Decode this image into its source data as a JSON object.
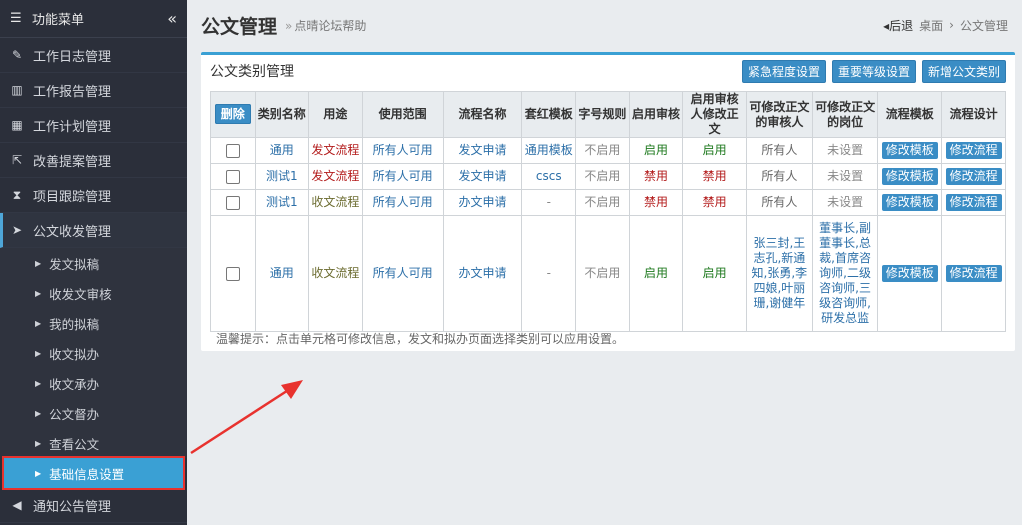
{
  "sidebar": {
    "header": "功能菜单",
    "collapse_glyph": "«",
    "items": [
      {
        "label": "工作日志管理",
        "icon": "✎"
      },
      {
        "label": "工作报告管理",
        "icon": "▥"
      },
      {
        "label": "工作计划管理",
        "icon": "▦"
      },
      {
        "label": "改善提案管理",
        "icon": "⇱"
      },
      {
        "label": "项目跟踪管理",
        "icon": "⧗"
      },
      {
        "label": "公文收发管理",
        "icon": "➤"
      }
    ],
    "subitems": [
      "发文拟稿",
      "收发文审核",
      "我的拟稿",
      "收文拟办",
      "收文承办",
      "公文督办",
      "查看公文",
      "基础信息设置"
    ],
    "last_item": {
      "label": "通知公告管理",
      "icon": "◀"
    }
  },
  "header": {
    "title": "公文管理",
    "subtitle": "点晴论坛帮助",
    "back": "后退",
    "crumb1": "桌面",
    "crumb2": "公文管理"
  },
  "panel": {
    "title": "公文类别管理",
    "buttons": [
      "紧急程度设置",
      "重要等级设置",
      "新增公文类别"
    ],
    "columns": [
      "删除",
      "类别名称",
      "用途",
      "使用范围",
      "流程名称",
      "套红模板",
      "字号规则",
      "启用审核",
      "启用审核人修改正文",
      "可修改正文的审核人",
      "可修改正文的岗位",
      "流程模板",
      "流程设计"
    ],
    "rows": [
      {
        "name": "通用",
        "usage": "发文流程",
        "scope": "所有人可用",
        "flow": "发文申请",
        "template": "通用模板",
        "rule": "不启用",
        "audit": "启用",
        "edit": "启用",
        "editors": "所有人",
        "posts": "未设置",
        "btn1": "修改模板",
        "btn2": "修改流程"
      },
      {
        "name": "测试1",
        "usage": "发文流程",
        "scope": "所有人可用",
        "flow": "发文申请",
        "template": "cscs",
        "rule": "不启用",
        "audit": "禁用",
        "edit": "禁用",
        "editors": "所有人",
        "posts": "未设置",
        "btn1": "修改模板",
        "btn2": "修改流程"
      },
      {
        "name": "测试1",
        "usage": "收文流程",
        "scope": "所有人可用",
        "flow": "办文申请",
        "template": "-",
        "rule": "不启用",
        "audit": "禁用",
        "edit": "禁用",
        "editors": "所有人",
        "posts": "未设置",
        "btn1": "修改模板",
        "btn2": "修改流程"
      },
      {
        "name": "通用",
        "usage": "收文流程",
        "scope": "所有人可用",
        "flow": "办文申请",
        "template": "-",
        "rule": "不启用",
        "audit": "启用",
        "edit": "启用",
        "editors": "张三封,王志孔,新通知,张勇,李四娘,叶丽珊,谢健年",
        "posts": "董事长,副董事长,总裁,首席咨询师,二级咨询师,三级咨询师,研发总监",
        "btn1": "修改模板",
        "btn2": "修改流程"
      }
    ],
    "tip": "温馨提示：点击单元格可修改信息，发文和拟办页面选择类别可以应用设置。"
  },
  "colors": {
    "accent": "#3aa0d4",
    "button": "#3a8dc5",
    "enabled": "#1f7a1f",
    "disabled": "#b31b1b",
    "highlight_border": "#e8322e"
  }
}
